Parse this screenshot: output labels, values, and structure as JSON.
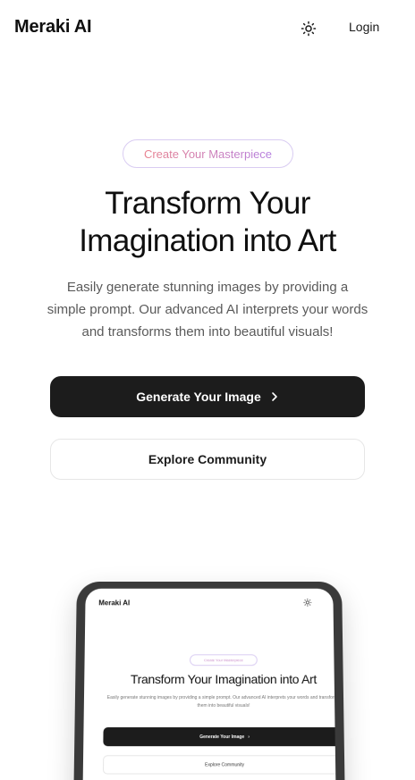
{
  "header": {
    "brand": "Meraki AI",
    "theme_icon": "sun-icon",
    "login_label": "Login"
  },
  "hero": {
    "badge": "Create Your Masterpiece",
    "title_line1": "Transform Your",
    "title_line2": "Imagination into Art",
    "description": "Easily generate stunning images by providing a simple prompt. Our advanced AI interprets your words and transforms them into beautiful visuals!",
    "primary_button": "Generate Your Image",
    "primary_button_icon": "chevron-right-icon",
    "secondary_button": "Explore Community"
  },
  "preview": {
    "brand": "Meraki AI",
    "badge": "Create Your Masterpiece",
    "title": "Transform Your Imagination into Art",
    "description": "Easily generate stunning images by providing a simple prompt. Our advanced AI interprets your words and transforms them into beautiful visuals!",
    "primary_button": "Generate Your Image",
    "secondary_button": "Explore Community"
  },
  "colors": {
    "primary_button_bg": "#1c1c1c",
    "badge_gradient_start": "#e8818e",
    "badge_gradient_end": "#b57ee0"
  }
}
